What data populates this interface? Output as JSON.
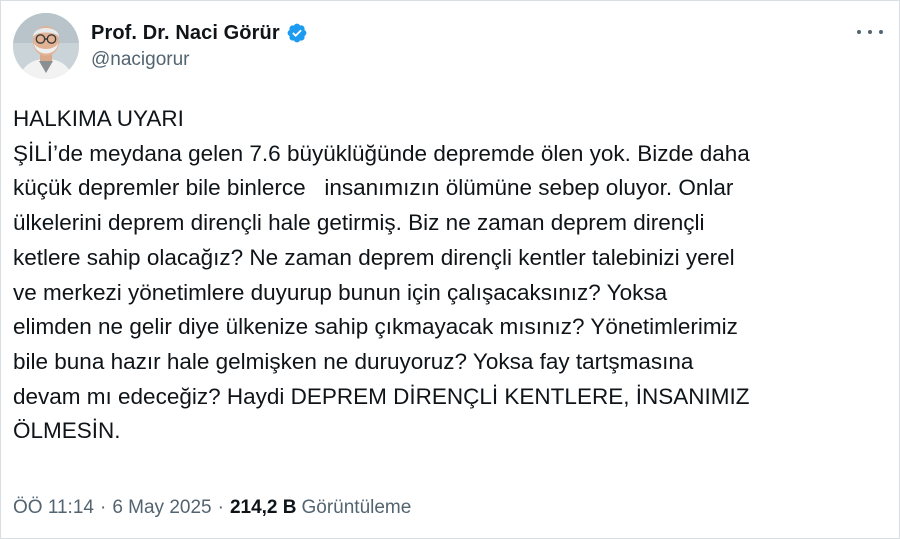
{
  "author": {
    "display_name": "Prof. Dr. Naci Görür",
    "handle": "@nacigorur",
    "verified": true
  },
  "tweet": {
    "text": "HALKIMA UYARI\nŞİLİ’de meydana gelen 7.6 büyüklüğünde depremde ölen yok. Bizde daha\nküçük depremler bile binlerce   insanımızın ölümüne sebep oluyor. Onlar\nülkelerini deprem dirençli hale getirmiş. Biz ne zaman deprem dirençli\nketlere sahip olacağız? Ne zaman deprem dirençli kentler talebinizi yerel\nve merkezi yönetimlere duyurup bunun için çalışacaksınız? Yoksa\nelimden ne gelir diye ülkenize sahip çıkmayacak mısınız? Yönetimlerimiz\nbile buna hazır hale gelmişken ne duruyoruz? Yoksa fay tartşmasına\ndevam mı edeceğiz? Haydi DEPREM DİRENÇLİ KENTLERE, İNSANIMIZ\nÖLMESİN."
  },
  "meta": {
    "time": "ÖÖ 11:14",
    "separator": "·",
    "date": "6 May 2025",
    "views_count": "214,2 B",
    "views_label": "Görüntüleme"
  },
  "icons": {
    "verified": "verified-badge-icon",
    "more": "more-options-icon"
  },
  "colors": {
    "text_primary": "#0f1419",
    "text_secondary": "#536471",
    "verified_blue": "#1d9bf0"
  }
}
